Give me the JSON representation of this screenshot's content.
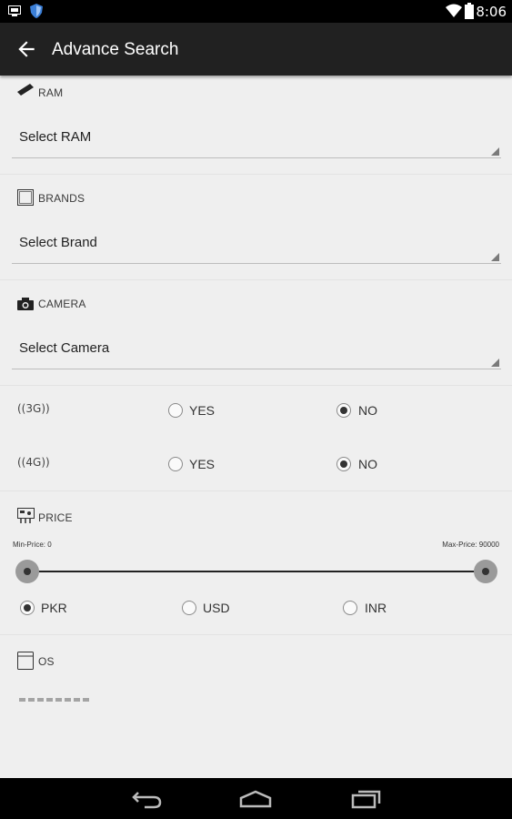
{
  "status_bar": {
    "time": "8:06"
  },
  "app_bar": {
    "title": "Advance Search"
  },
  "sections": {
    "ram": {
      "label": "RAM",
      "select_value": "Select RAM"
    },
    "brands": {
      "label": "BRANDS",
      "select_value": "Select Brand"
    },
    "camera": {
      "label": "CAMERA",
      "select_value": "Select Camera"
    },
    "net_3g": {
      "label": "3G",
      "options": [
        "YES",
        "NO"
      ],
      "selected": "NO"
    },
    "net_4g": {
      "label": "4G",
      "options": [
        "YES",
        "NO"
      ],
      "selected": "NO"
    },
    "price": {
      "label": "PRICE",
      "min_label": "Min-Price: 0",
      "max_label": "Max-Price: 90000",
      "min_value": 0,
      "max_value": 90000,
      "currencies": [
        "PKR",
        "USD",
        "INR"
      ],
      "selected_currency": "PKR"
    },
    "os": {
      "label": "OS"
    }
  },
  "colors": {
    "app_bar": "#212121",
    "background": "#efefef",
    "status_bar": "#000000"
  },
  "icons": [
    "screenshot-icon",
    "shield-icon",
    "wifi-icon",
    "battery-icon",
    "back-arrow-icon",
    "ram-icon",
    "brand-icon",
    "camera-icon",
    "price-icon",
    "os-icon",
    "nav-back-icon",
    "nav-home-icon",
    "nav-recents-icon"
  ]
}
